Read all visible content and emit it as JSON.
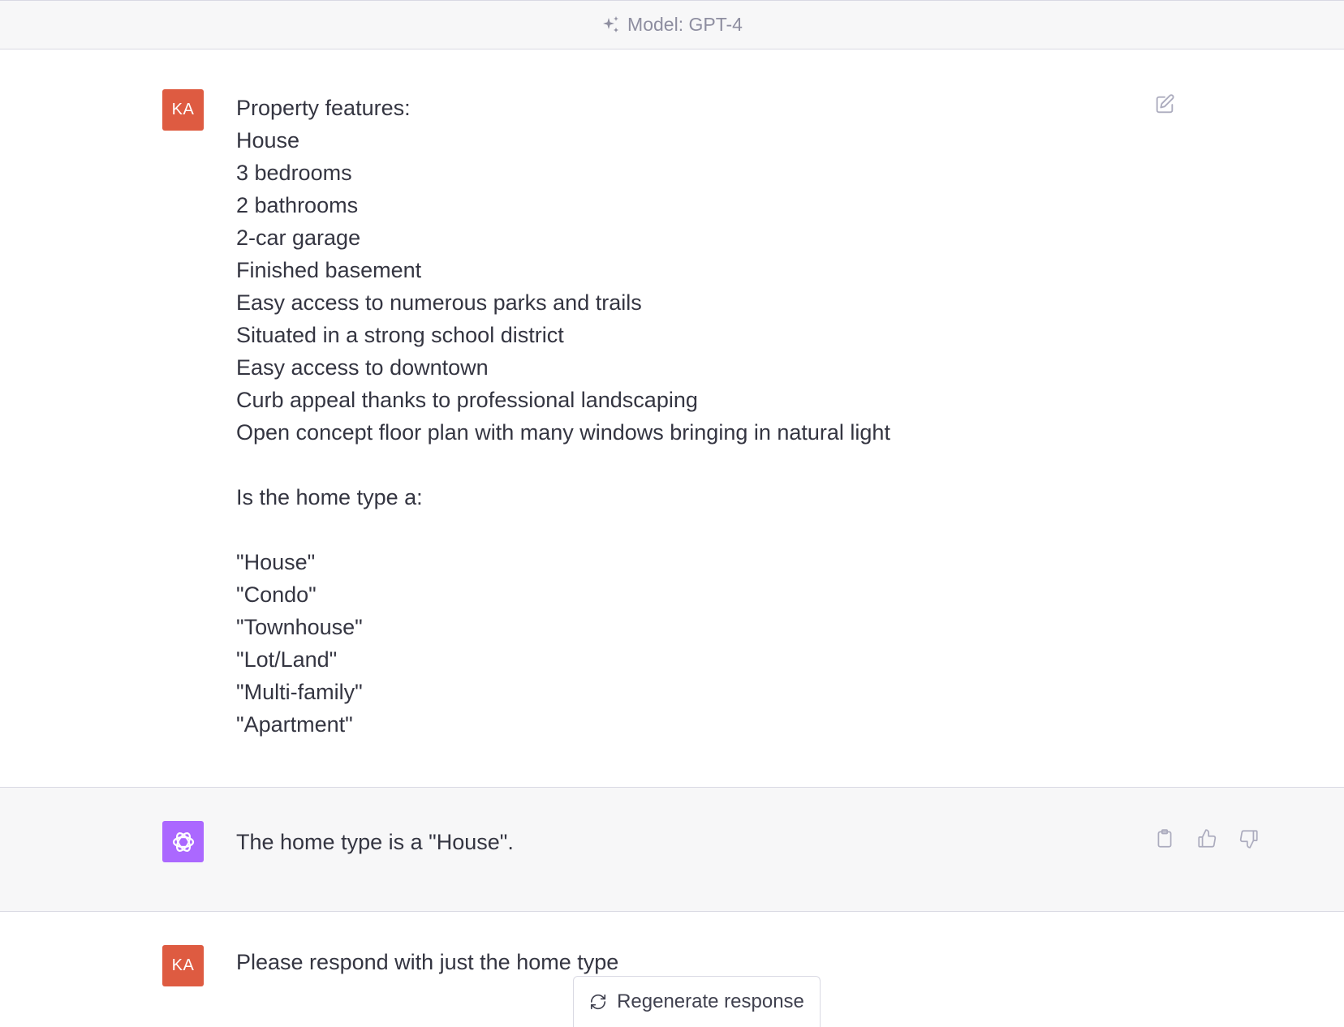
{
  "header": {
    "model_label": "Model: GPT-4",
    "icon": "sparkles-icon"
  },
  "messages": {
    "user1": {
      "avatar_initials": "KA",
      "lines": [
        "Property features:",
        "House",
        "3 bedrooms",
        "2 bathrooms",
        "2-car garage",
        "Finished basement",
        "Easy access to numerous parks and trails",
        "Situated in a strong school district",
        "Easy access to downtown",
        "Curb appeal thanks to professional landscaping",
        "Open concept floor plan with many windows bringing in natural light",
        "",
        "Is the home type a:",
        "",
        "\"House\"",
        "\"Condo\"",
        "\"Townhouse\"",
        "\"Lot/Land\"",
        "\"Multi-family\"",
        "\"Apartment\""
      ],
      "edit_icon": "edit-icon"
    },
    "assistant": {
      "avatar_icon": "openai-logo-icon",
      "text": "The home type is a \"House\".",
      "action_icons": [
        "clipboard-icon",
        "thumbs-up-icon",
        "thumbs-down-icon"
      ]
    },
    "user2": {
      "avatar_initials": "KA",
      "text": "Please respond with just the home type"
    }
  },
  "regenerate": {
    "label": "Regenerate response",
    "icon": "refresh-icon"
  },
  "colors": {
    "user_avatar": "#de5b41",
    "assistant_avatar": "#ab68ff",
    "header_bg": "#f7f7f8",
    "assistant_row_bg": "#f7f7f8",
    "text": "#343541",
    "muted_icon": "#acacbe"
  }
}
